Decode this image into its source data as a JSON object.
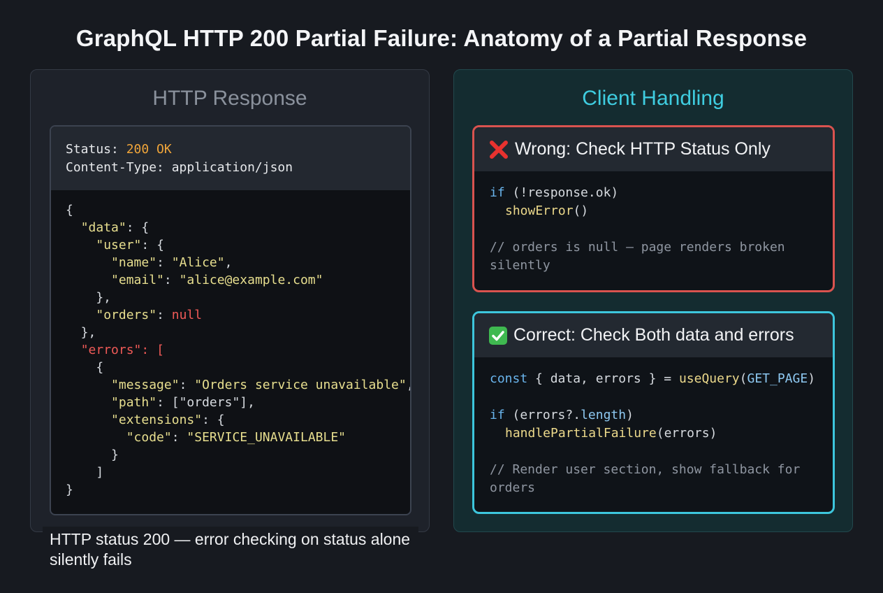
{
  "title": "GraphQL HTTP 200 Partial Failure: Anatomy of a Partial Response",
  "left_panel": {
    "title": "HTTP Response",
    "status_label": "Status: ",
    "status_value": "200 OK",
    "content_type": "Content-Type: application/json",
    "json": {
      "data_key": "\"data\"",
      "user_key": "\"user\"",
      "name_key": "\"name\"",
      "name_value": "\"Alice\"",
      "email_key": "\"email\"",
      "email_value": "\"alice@example.com\"",
      "orders_key": "\"orders\"",
      "orders_value": "null",
      "errors_key": "\"errors\"",
      "message_key": "\"message\"",
      "message_value": "\"Orders service unavailable\"",
      "path_key": "\"path\"",
      "path_value": "[\"orders\"]",
      "extensions_key": "\"extensions\"",
      "code_key": "\"code\"",
      "code_value": "\"SERVICE_UNAVAILABLE\""
    },
    "caption": "HTTP status 200 — error checking on status alone silently fails"
  },
  "right_panel": {
    "title": "Client Handling",
    "wrong": {
      "heading": "Wrong: Check HTTP Status Only",
      "icon": "red-x-icon",
      "code_if": "if",
      "code_cond": " (!response.ok)",
      "code_call": "showError",
      "code_parens": "()",
      "comment": "// orders is null — page renders broken silently"
    },
    "correct": {
      "heading": "Correct: Check Both data and errors",
      "icon": "green-check-icon",
      "const_kw": "const",
      "destructure": " { data, errors } = ",
      "use_query": "useQuery",
      "query_arg": "GET_PAGE",
      "if_kw": "if",
      "if_cond_a": " (errors?.",
      "if_cond_b": "length",
      "if_cond_c": ")",
      "handler": "handlePartialFailure",
      "handler_arg": "(errors)",
      "comment": "// Render user section, show fallback for orders"
    }
  },
  "colors": {
    "status_ok": "#f0a53a",
    "error_red": "#ef5a57",
    "accent_cyan": "#3fcde0"
  }
}
